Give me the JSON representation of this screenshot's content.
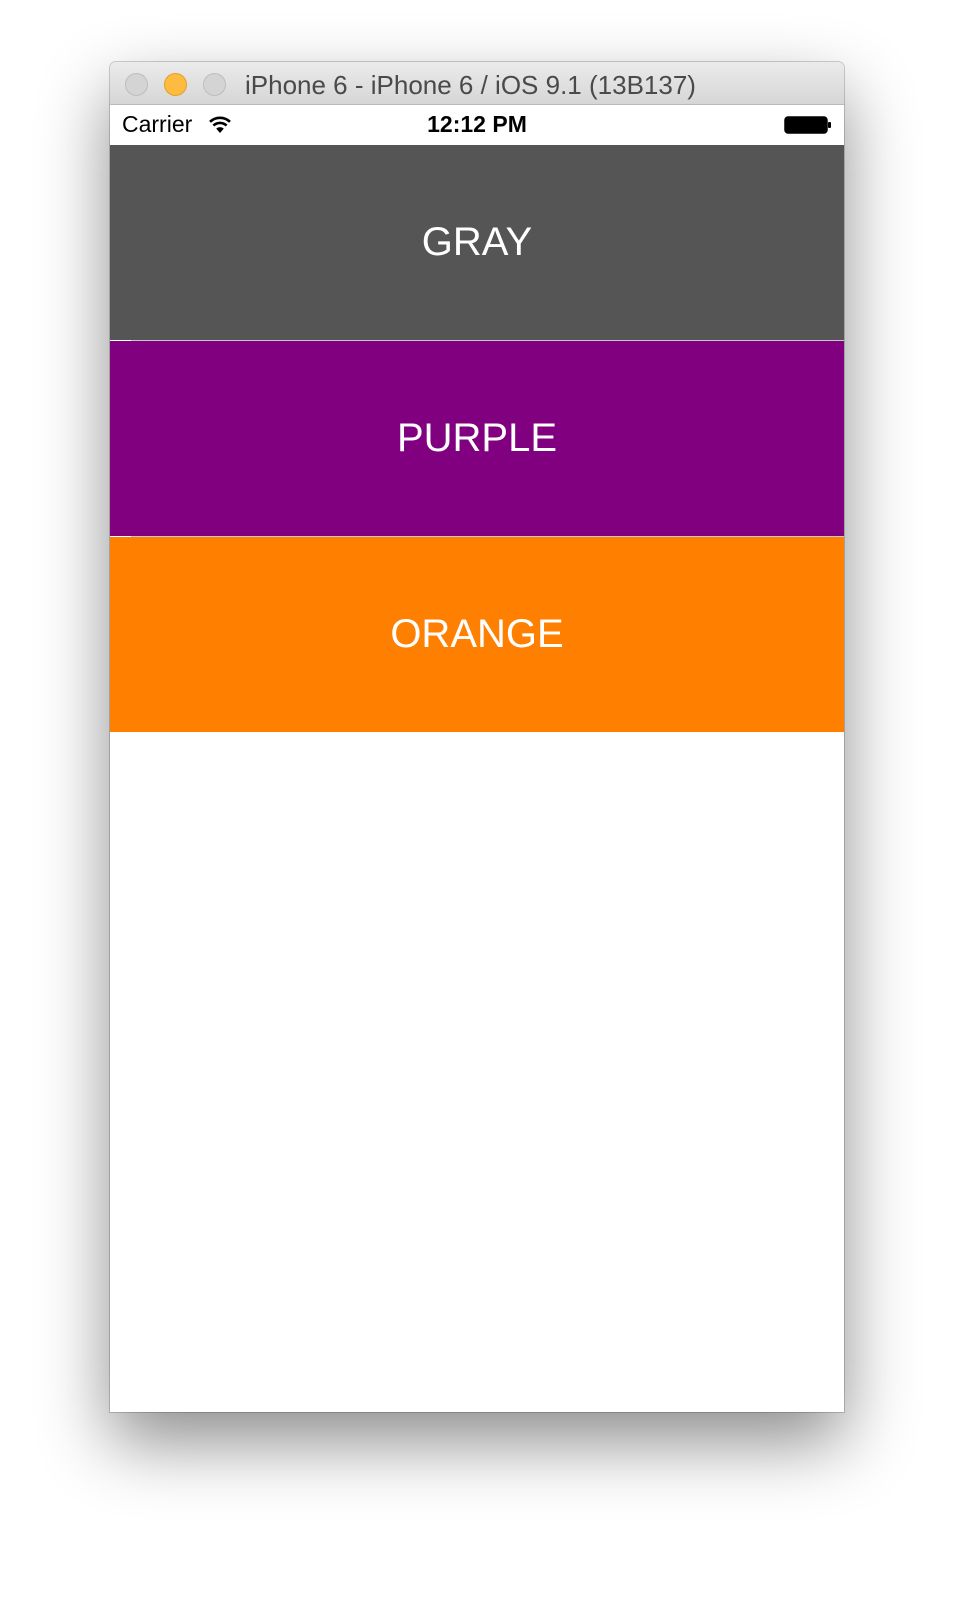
{
  "window": {
    "title": "iPhone 6 - iPhone 6 / iOS 9.1 (13B137)",
    "buttons": {
      "close_color": "#d4d4d4",
      "minimize_color": "#fdbc40",
      "zoom_color": "#d4d4d4"
    }
  },
  "status_bar": {
    "carrier": "Carrier",
    "wifi_icon": "wifi-icon",
    "time": "12:12 PM",
    "battery_icon": "battery-full-icon"
  },
  "table": {
    "rows": [
      {
        "label": "GRAY",
        "color": "#555555"
      },
      {
        "label": "PURPLE",
        "color": "#800080"
      },
      {
        "label": "ORANGE",
        "color": "#ff7f00"
      }
    ]
  }
}
